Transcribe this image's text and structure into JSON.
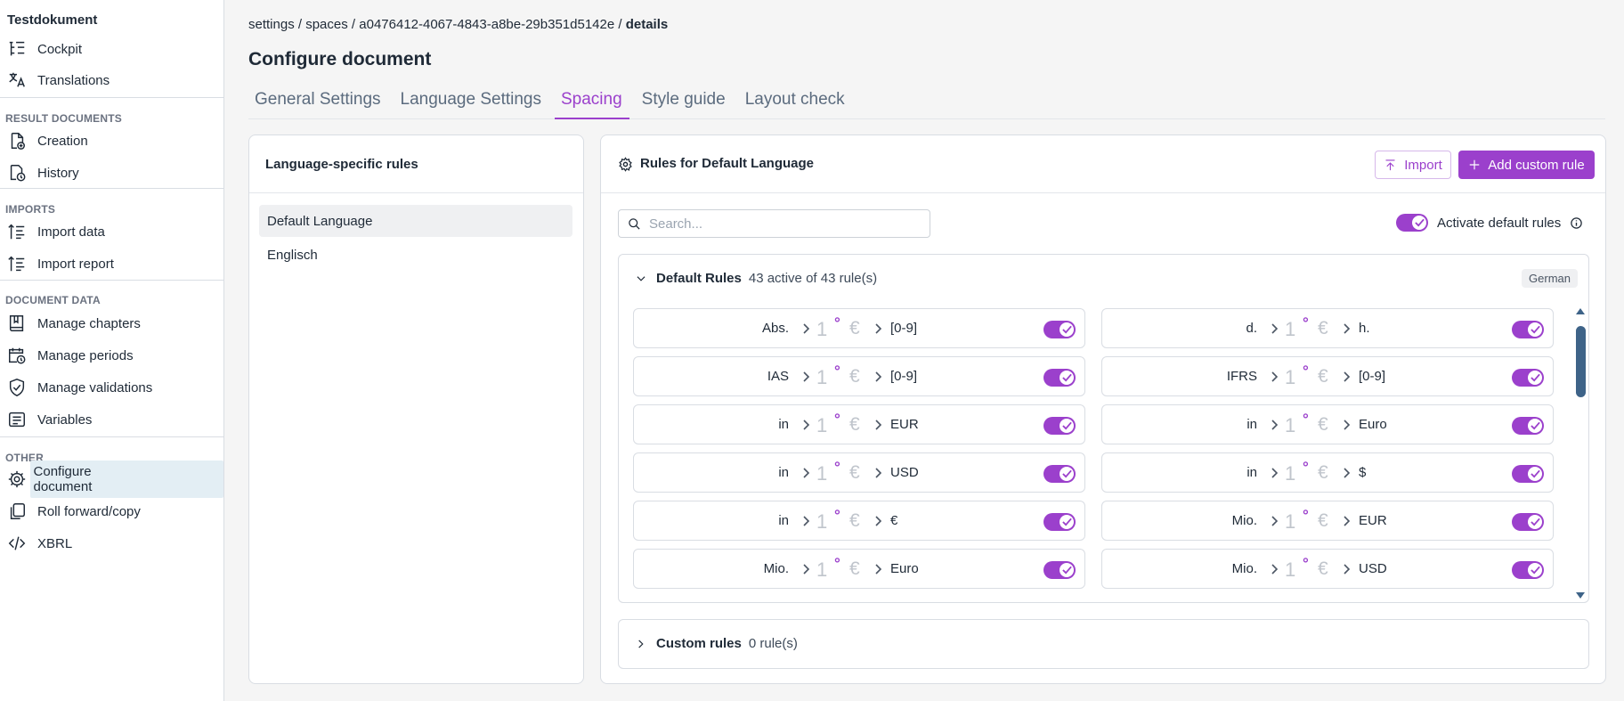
{
  "sidebar": {
    "app_title": "Testdokument",
    "top_items": [
      {
        "label": "Cockpit",
        "icon": "cockpit-icon"
      },
      {
        "label": "Translations",
        "icon": "translate-icon"
      }
    ],
    "sections": [
      {
        "title": "RESULT DOCUMENTS",
        "items": [
          {
            "label": "Creation",
            "icon": "creation-icon"
          },
          {
            "label": "History",
            "icon": "history-icon"
          }
        ]
      },
      {
        "title": "IMPORTS",
        "items": [
          {
            "label": "Import data",
            "icon": "import-data-icon"
          },
          {
            "label": "Import report",
            "icon": "import-report-icon"
          }
        ]
      },
      {
        "title": "DOCUMENT DATA",
        "items": [
          {
            "label": "Manage chapters",
            "icon": "book-icon"
          },
          {
            "label": "Manage periods",
            "icon": "calendar-clock-icon"
          },
          {
            "label": "Manage validations",
            "icon": "shield-check-icon"
          },
          {
            "label": "Variables",
            "icon": "variables-icon"
          }
        ]
      },
      {
        "title": "OTHER",
        "items": [
          {
            "label": "Configure document",
            "icon": "gear-icon",
            "active": true
          },
          {
            "label": "Roll forward/copy",
            "icon": "copy-icon"
          },
          {
            "label": "XBRL",
            "icon": "code-icon"
          }
        ]
      }
    ]
  },
  "breadcrumb": {
    "parts": [
      "settings",
      "spaces",
      "a0476412-4067-4843-a8be-29b351d5142e"
    ],
    "separator": " / ",
    "last": "details"
  },
  "page_title": "Configure document",
  "tabs": [
    {
      "label": "General Settings"
    },
    {
      "label": "Language Settings"
    },
    {
      "label": "Spacing",
      "active": true
    },
    {
      "label": "Style guide"
    },
    {
      "label": "Layout check"
    }
  ],
  "language_panel": {
    "title": "Language-specific rules",
    "items": [
      {
        "label": "Default Language",
        "selected": true
      },
      {
        "label": "Englisch"
      }
    ]
  },
  "rules_panel": {
    "title": "Rules for Default Language",
    "import_label": "Import",
    "add_label": "Add custom rule",
    "search_placeholder": "Search...",
    "activate_label": "Activate default rules",
    "default_rules": {
      "name": "Default Rules",
      "count_text": "43 active of 43 rule(s)",
      "badge": "German"
    },
    "custom_rules": {
      "name": "Custom rules",
      "count_text": "0 rule(s)"
    },
    "sample_digit": "1",
    "sample_degree": "°",
    "sample_currency": "€",
    "rules": [
      {
        "before": "Abs.",
        "after": "[0-9]",
        "enabled": true
      },
      {
        "before": "d.",
        "after": "h.",
        "enabled": true
      },
      {
        "before": "IAS",
        "after": "[0-9]",
        "enabled": true
      },
      {
        "before": "IFRS",
        "after": "[0-9]",
        "enabled": true
      },
      {
        "before": "in",
        "after": "EUR",
        "enabled": true
      },
      {
        "before": "in",
        "after": "Euro",
        "enabled": true
      },
      {
        "before": "in",
        "after": "USD",
        "enabled": true
      },
      {
        "before": "in",
        "after": "$",
        "enabled": true
      },
      {
        "before": "in",
        "after": "€",
        "enabled": true
      },
      {
        "before": "Mio.",
        "after": "EUR",
        "enabled": true
      },
      {
        "before": "Mio.",
        "after": "Euro",
        "enabled": true
      },
      {
        "before": "Mio.",
        "after": "USD",
        "enabled": true
      }
    ]
  },
  "colors": {
    "accent": "#9b40cc",
    "active_nav_bg": "#e3eef4",
    "scrollbar": "#3e6388"
  }
}
